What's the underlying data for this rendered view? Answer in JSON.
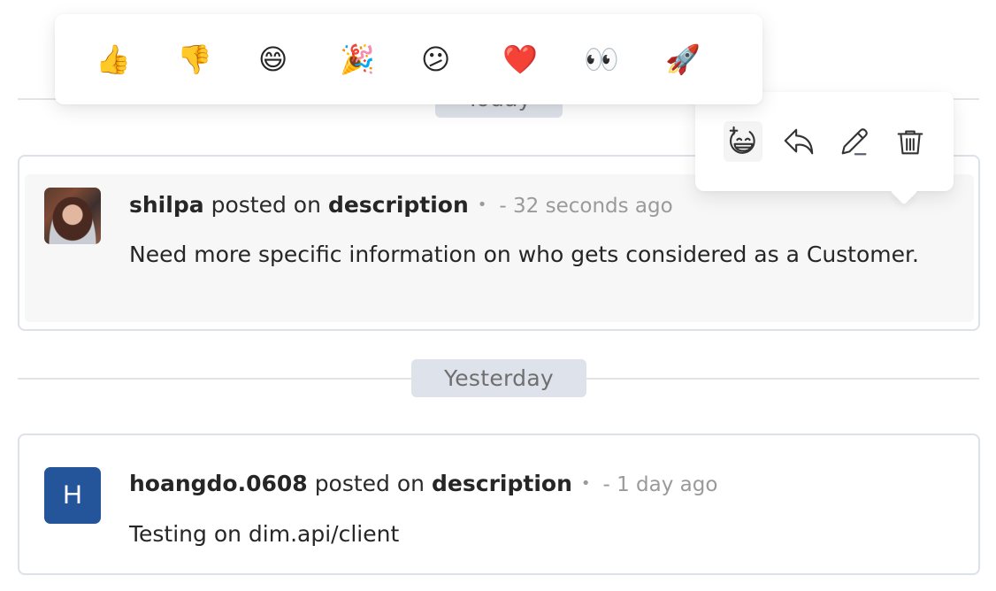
{
  "emoji_picker": {
    "emojis": [
      {
        "name": "thumbs-up",
        "glyph": "👍"
      },
      {
        "name": "thumbs-down",
        "glyph": "👎"
      },
      {
        "name": "grinning-face",
        "glyph": "😄"
      },
      {
        "name": "party-popper",
        "glyph": "🎉"
      },
      {
        "name": "confused-face",
        "glyph": "😕"
      },
      {
        "name": "red-heart",
        "glyph": "❤️"
      },
      {
        "name": "eyes",
        "glyph": "👀"
      },
      {
        "name": "rocket",
        "glyph": "🚀"
      }
    ]
  },
  "action_toolbar": {
    "actions": [
      {
        "name": "add-reaction",
        "icon": "add-reaction-icon",
        "active": true
      },
      {
        "name": "reply",
        "icon": "reply-icon"
      },
      {
        "name": "edit",
        "icon": "pencil-icon"
      },
      {
        "name": "delete",
        "icon": "trash-icon"
      }
    ]
  },
  "groups": [
    {
      "label": "Today",
      "comments": [
        {
          "author": "shilpa",
          "verb": "posted on",
          "target": "description",
          "separator": "•",
          "time": "- 32 seconds ago",
          "text": "Need more specific information on who gets considered as a Customer.",
          "avatar": {
            "type": "photo"
          }
        }
      ]
    },
    {
      "label": "Yesterday",
      "comments": [
        {
          "author": "hoangdo.0608",
          "verb": "posted on",
          "target": "description",
          "separator": "•",
          "time": "- 1 day ago",
          "text": "Testing on dim.api/client",
          "avatar": {
            "type": "initial",
            "initial": "H",
            "color": "#24559a"
          }
        }
      ]
    }
  ],
  "colors": {
    "pill_bg": "#dee2ea",
    "card_border": "#dde1e9",
    "highlight_bg": "#f7f7f7",
    "avatar_blue": "#24559a",
    "muted_text": "#9a9a9a"
  }
}
